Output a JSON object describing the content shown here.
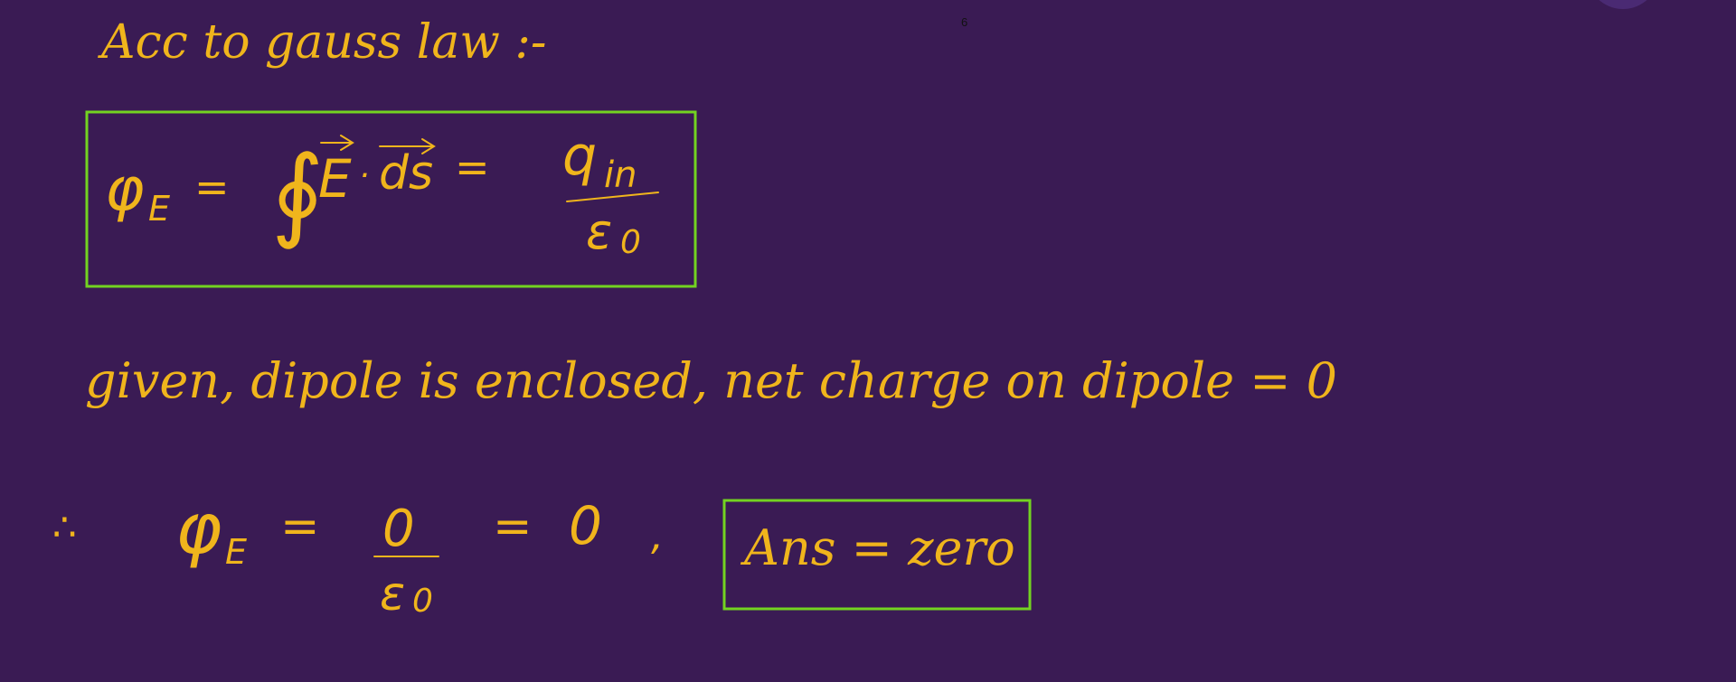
{
  "page_number": "6",
  "colors": {
    "background": "#3a1b54",
    "ink": "#f0b51c",
    "box": "#73d321",
    "page_number": "#111111",
    "bubble": "#4a2a73"
  },
  "heading": "Acc to gauss law :-",
  "formula_box": {
    "phi": "φ",
    "phi_sub": "E",
    "equals_1": "=",
    "integral": "∮",
    "vector_e": "E",
    "dot": "·",
    "vector_ds": "ds",
    "equals_2": "=",
    "numerator": "q",
    "numerator_sub": "in",
    "denominator": "ε",
    "denominator_sub": "0"
  },
  "given_line": "given, dipole is enclosed, net charge on dipole = 0",
  "conclusion": {
    "therefore": "∴",
    "phi": "φ",
    "phi_sub": "E",
    "equals_1": "=",
    "numerator": "0",
    "denominator": "ε",
    "denominator_sub": "0",
    "equals_2": "=",
    "result": "0",
    "comma": ","
  },
  "answer_box": {
    "text": "Ans = zero"
  },
  "icons": {
    "corner_bubble": "circle-shape"
  }
}
